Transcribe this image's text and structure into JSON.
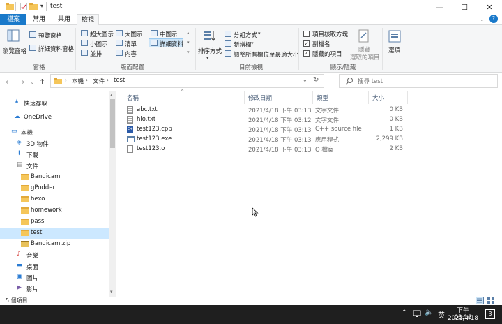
{
  "window": {
    "title": "test",
    "minimize": "—",
    "maximize": "☐",
    "close": "✕",
    "help": "?"
  },
  "tabs": {
    "file": "檔案",
    "home": "常用",
    "share": "共用",
    "view": "檢視"
  },
  "ribbon": {
    "panes": {
      "nav_pane": "瀏覽窗格",
      "preview": "預覽窗格",
      "details_pane": "詳細資料窗格",
      "label": "窗格"
    },
    "layout": {
      "extra_large": "超大圖示",
      "large": "大圖示",
      "medium": "中圖示",
      "small": "小圖示",
      "list": "清單",
      "details": "詳細資料",
      "tiles": "並排",
      "content": "內容",
      "label": "版面配置"
    },
    "current_view": {
      "sort": "排序方式",
      "group": "分組方式",
      "add_columns": "新增欄",
      "fit_columns": "調整所有欄位至最適大小",
      "label": "目前檢視"
    },
    "show_hide": {
      "item_checkboxes": "項目核取方塊",
      "extensions": "副檔名",
      "hidden_items": "隱藏的項目",
      "hide_selected_1": "隱藏",
      "hide_selected_2": "選取的項目",
      "options": "選項",
      "label": "顯示/隱藏"
    }
  },
  "address": {
    "crumb1": "本機",
    "crumb2": "文件",
    "crumb3": "test",
    "search_placeholder": "搜尋 test"
  },
  "nav": {
    "items": [
      {
        "label": "快速存取",
        "type": "star"
      },
      {
        "label": "OneDrive",
        "type": "cloud"
      },
      {
        "label": "本機",
        "type": "pc"
      },
      {
        "label": "3D 物件",
        "type": "cube"
      },
      {
        "label": "下載",
        "type": "download"
      },
      {
        "label": "文件",
        "type": "doc"
      },
      {
        "label": "Bandicam",
        "type": "folder"
      },
      {
        "label": "gPodder",
        "type": "folder"
      },
      {
        "label": "hexo",
        "type": "folder"
      },
      {
        "label": "homework",
        "type": "folder"
      },
      {
        "label": "pass",
        "type": "folder"
      },
      {
        "label": "test",
        "type": "folder"
      },
      {
        "label": "Bandicam.zip",
        "type": "zip"
      },
      {
        "label": "音樂",
        "type": "music"
      },
      {
        "label": "桌面",
        "type": "desktop"
      },
      {
        "label": "圖片",
        "type": "pictures"
      },
      {
        "label": "影片",
        "type": "video"
      }
    ]
  },
  "columns": {
    "name": "名稱",
    "date": "修改日期",
    "type": "類型",
    "size": "大小"
  },
  "files": [
    {
      "name": "abc.txt",
      "date": "2021/4/18 下午 03:13",
      "type": "文字文件",
      "size": "0 KB",
      "icon": "txt"
    },
    {
      "name": "hlo.txt",
      "date": "2021/4/18 下午 03:12",
      "type": "文字文件",
      "size": "0 KB",
      "icon": "txt"
    },
    {
      "name": "test123.cpp",
      "date": "2021/4/18 下午 03:13",
      "type": "C++ source file",
      "size": "1 KB",
      "icon": "cpp"
    },
    {
      "name": "test123.exe",
      "date": "2021/4/18 下午 03:13",
      "type": "應用程式",
      "size": "2,299 KB",
      "icon": "exe"
    },
    {
      "name": "test123.o",
      "date": "2021/4/18 下午 03:13",
      "type": "O 檔案",
      "size": "2 KB",
      "icon": "file"
    }
  ],
  "status": {
    "count": "5 個項目"
  },
  "taskbar": {
    "ime": "英",
    "time": "下午 03:16",
    "date": "2021/4/18",
    "notif_count": "3"
  },
  "colors": {
    "file_tab": "#1979ca",
    "selected_nav": "#cce8ff",
    "folder": "#f5c65a",
    "taskbar": "#1f1f1f"
  }
}
